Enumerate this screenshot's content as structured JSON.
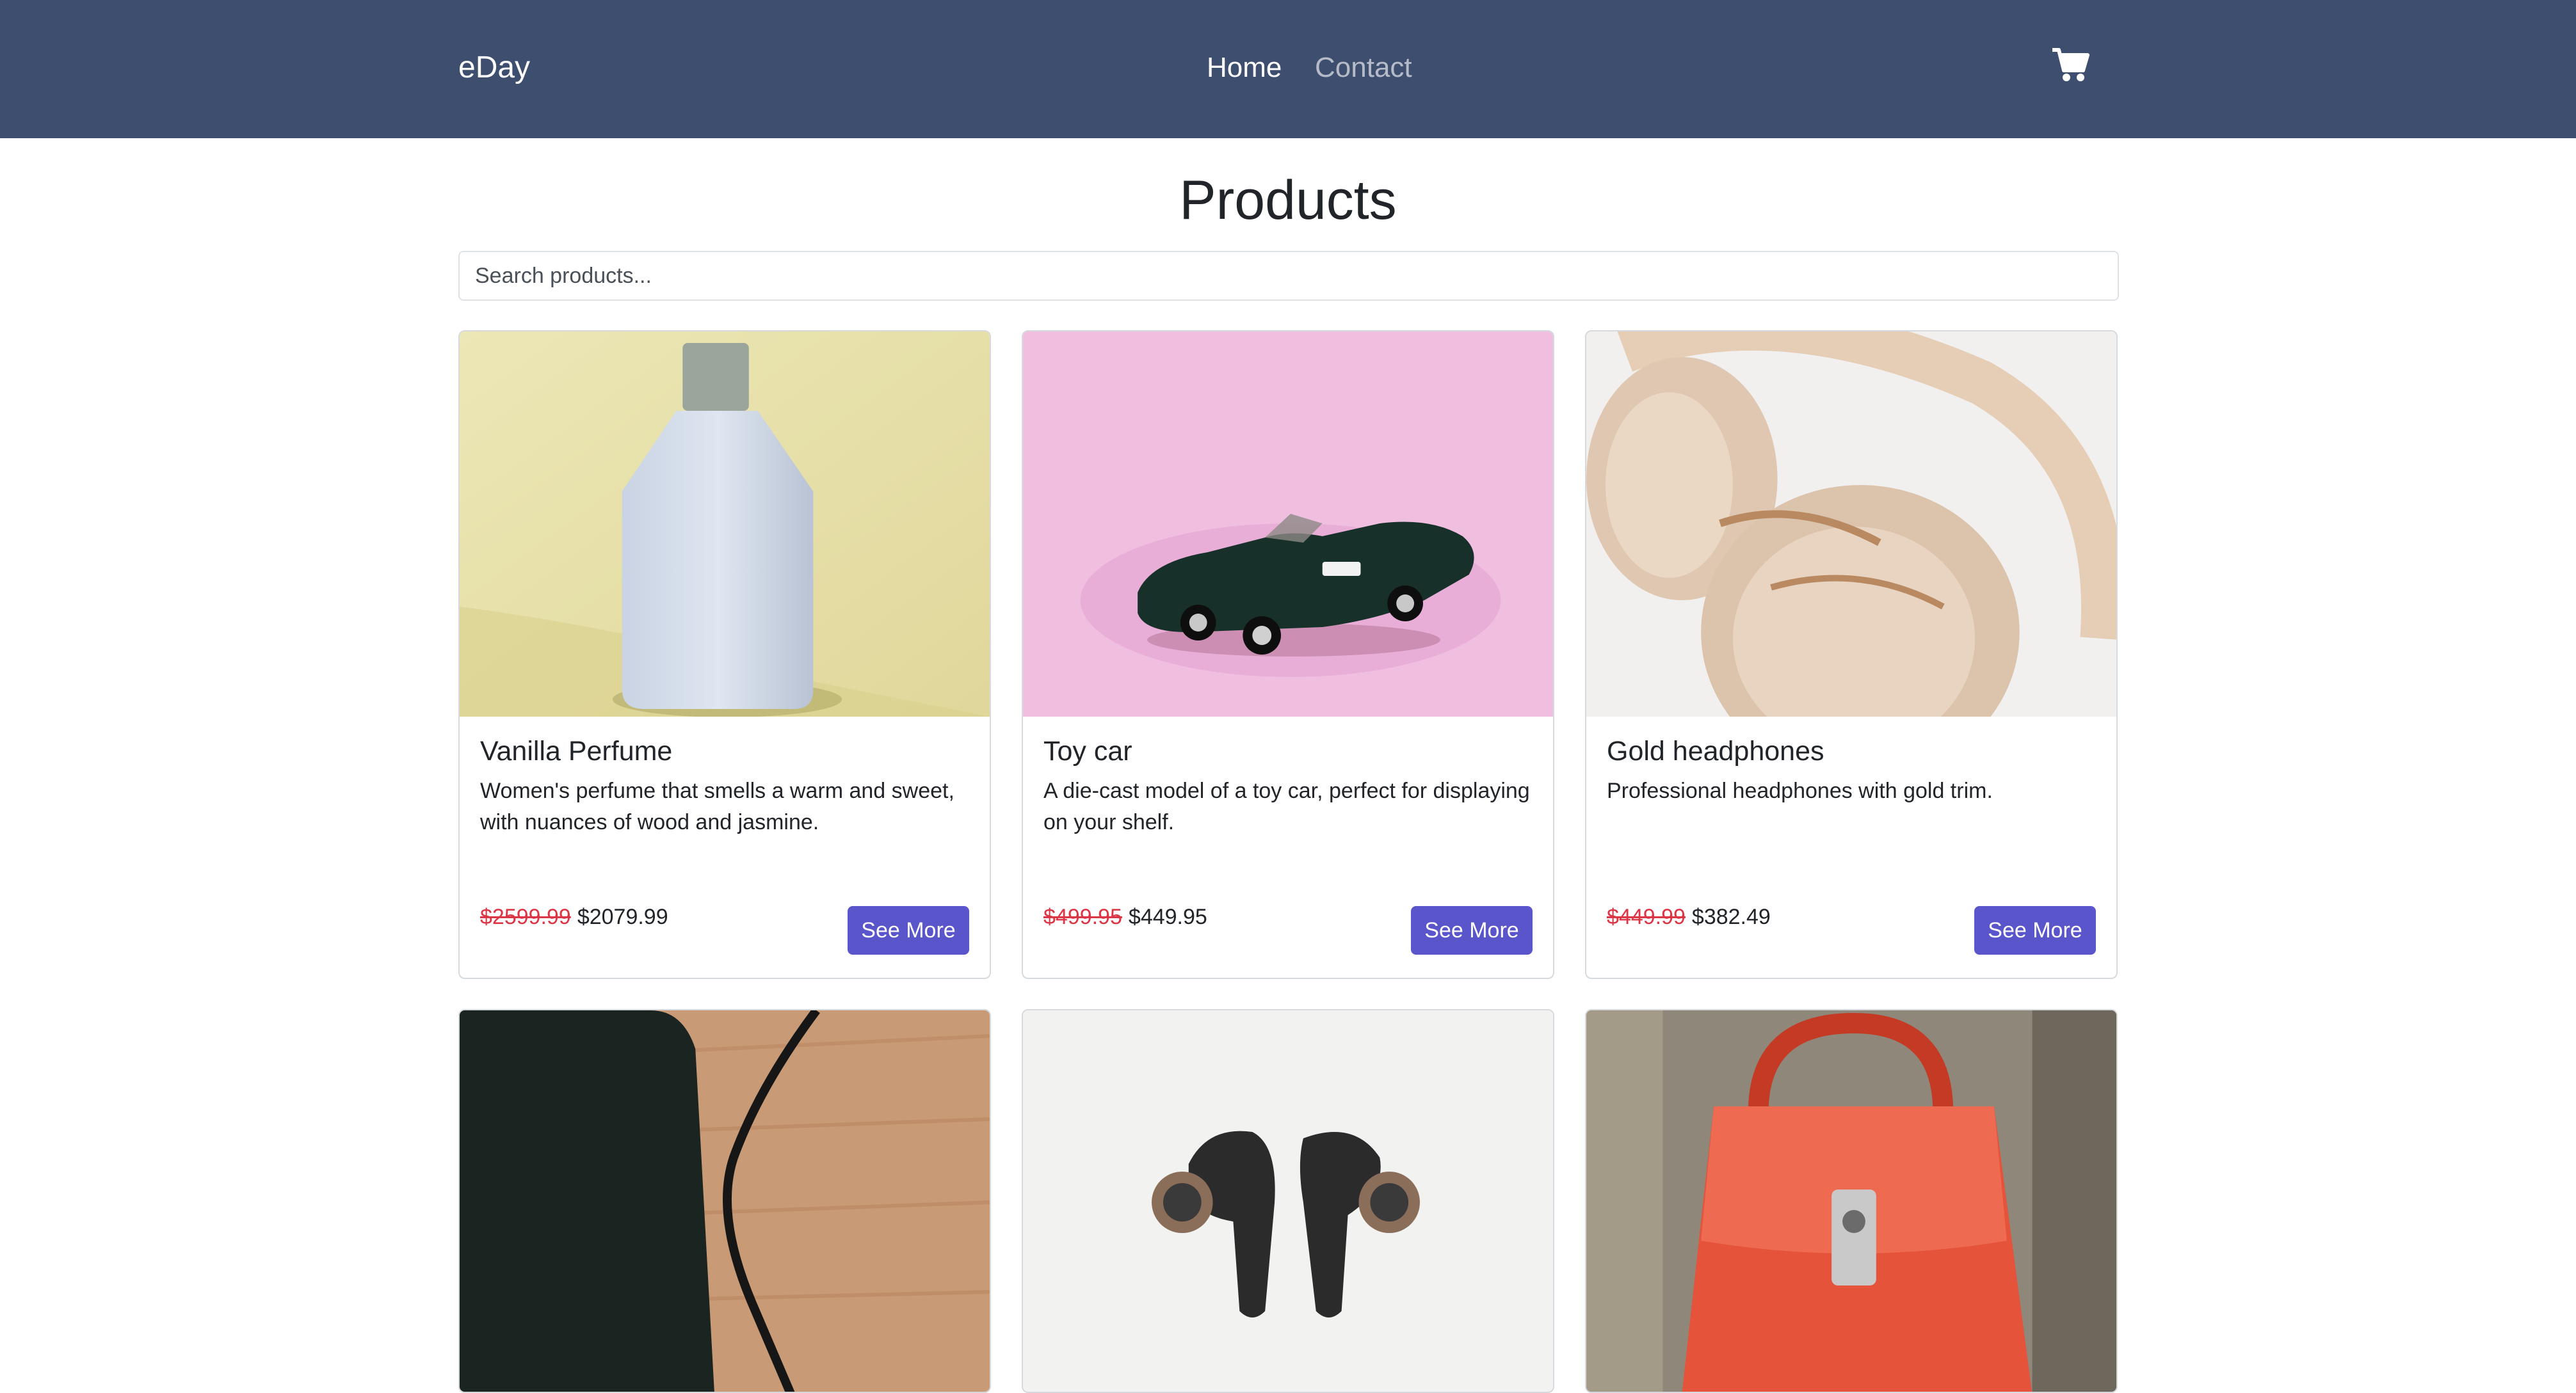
{
  "navbar": {
    "brand": "eDay",
    "links": [
      {
        "label": "Home",
        "active": true
      },
      {
        "label": "Contact",
        "active": false
      }
    ],
    "cart_icon": "shopping-cart-icon"
  },
  "page": {
    "title": "Products"
  },
  "search": {
    "placeholder": "Search products...",
    "value": ""
  },
  "colors": {
    "navbar_bg": "#3e4e6e",
    "button_bg": "#5b55cc",
    "old_price": "#dc3545"
  },
  "products": [
    {
      "name": "Vanilla Perfume",
      "description": "Women's perfume that smells a warm and sweet, with nuances of wood and jasmine.",
      "old_price": "$2599.99",
      "price": "$2079.99",
      "button": "See More",
      "image": "perfume-bottle"
    },
    {
      "name": "Toy car",
      "description": "A die-cast model of a toy car, perfect for displaying on your shelf.",
      "old_price": "$499.95",
      "price": "$449.95",
      "button": "See More",
      "image": "toy-car"
    },
    {
      "name": "Gold headphones",
      "description": "Professional headphones with gold trim.",
      "old_price": "$449.99",
      "price": "$382.49",
      "button": "See More",
      "image": "gold-headphones"
    },
    {
      "image": "phone-with-cable"
    },
    {
      "image": "wireless-earbuds"
    },
    {
      "image": "red-handbag"
    }
  ]
}
